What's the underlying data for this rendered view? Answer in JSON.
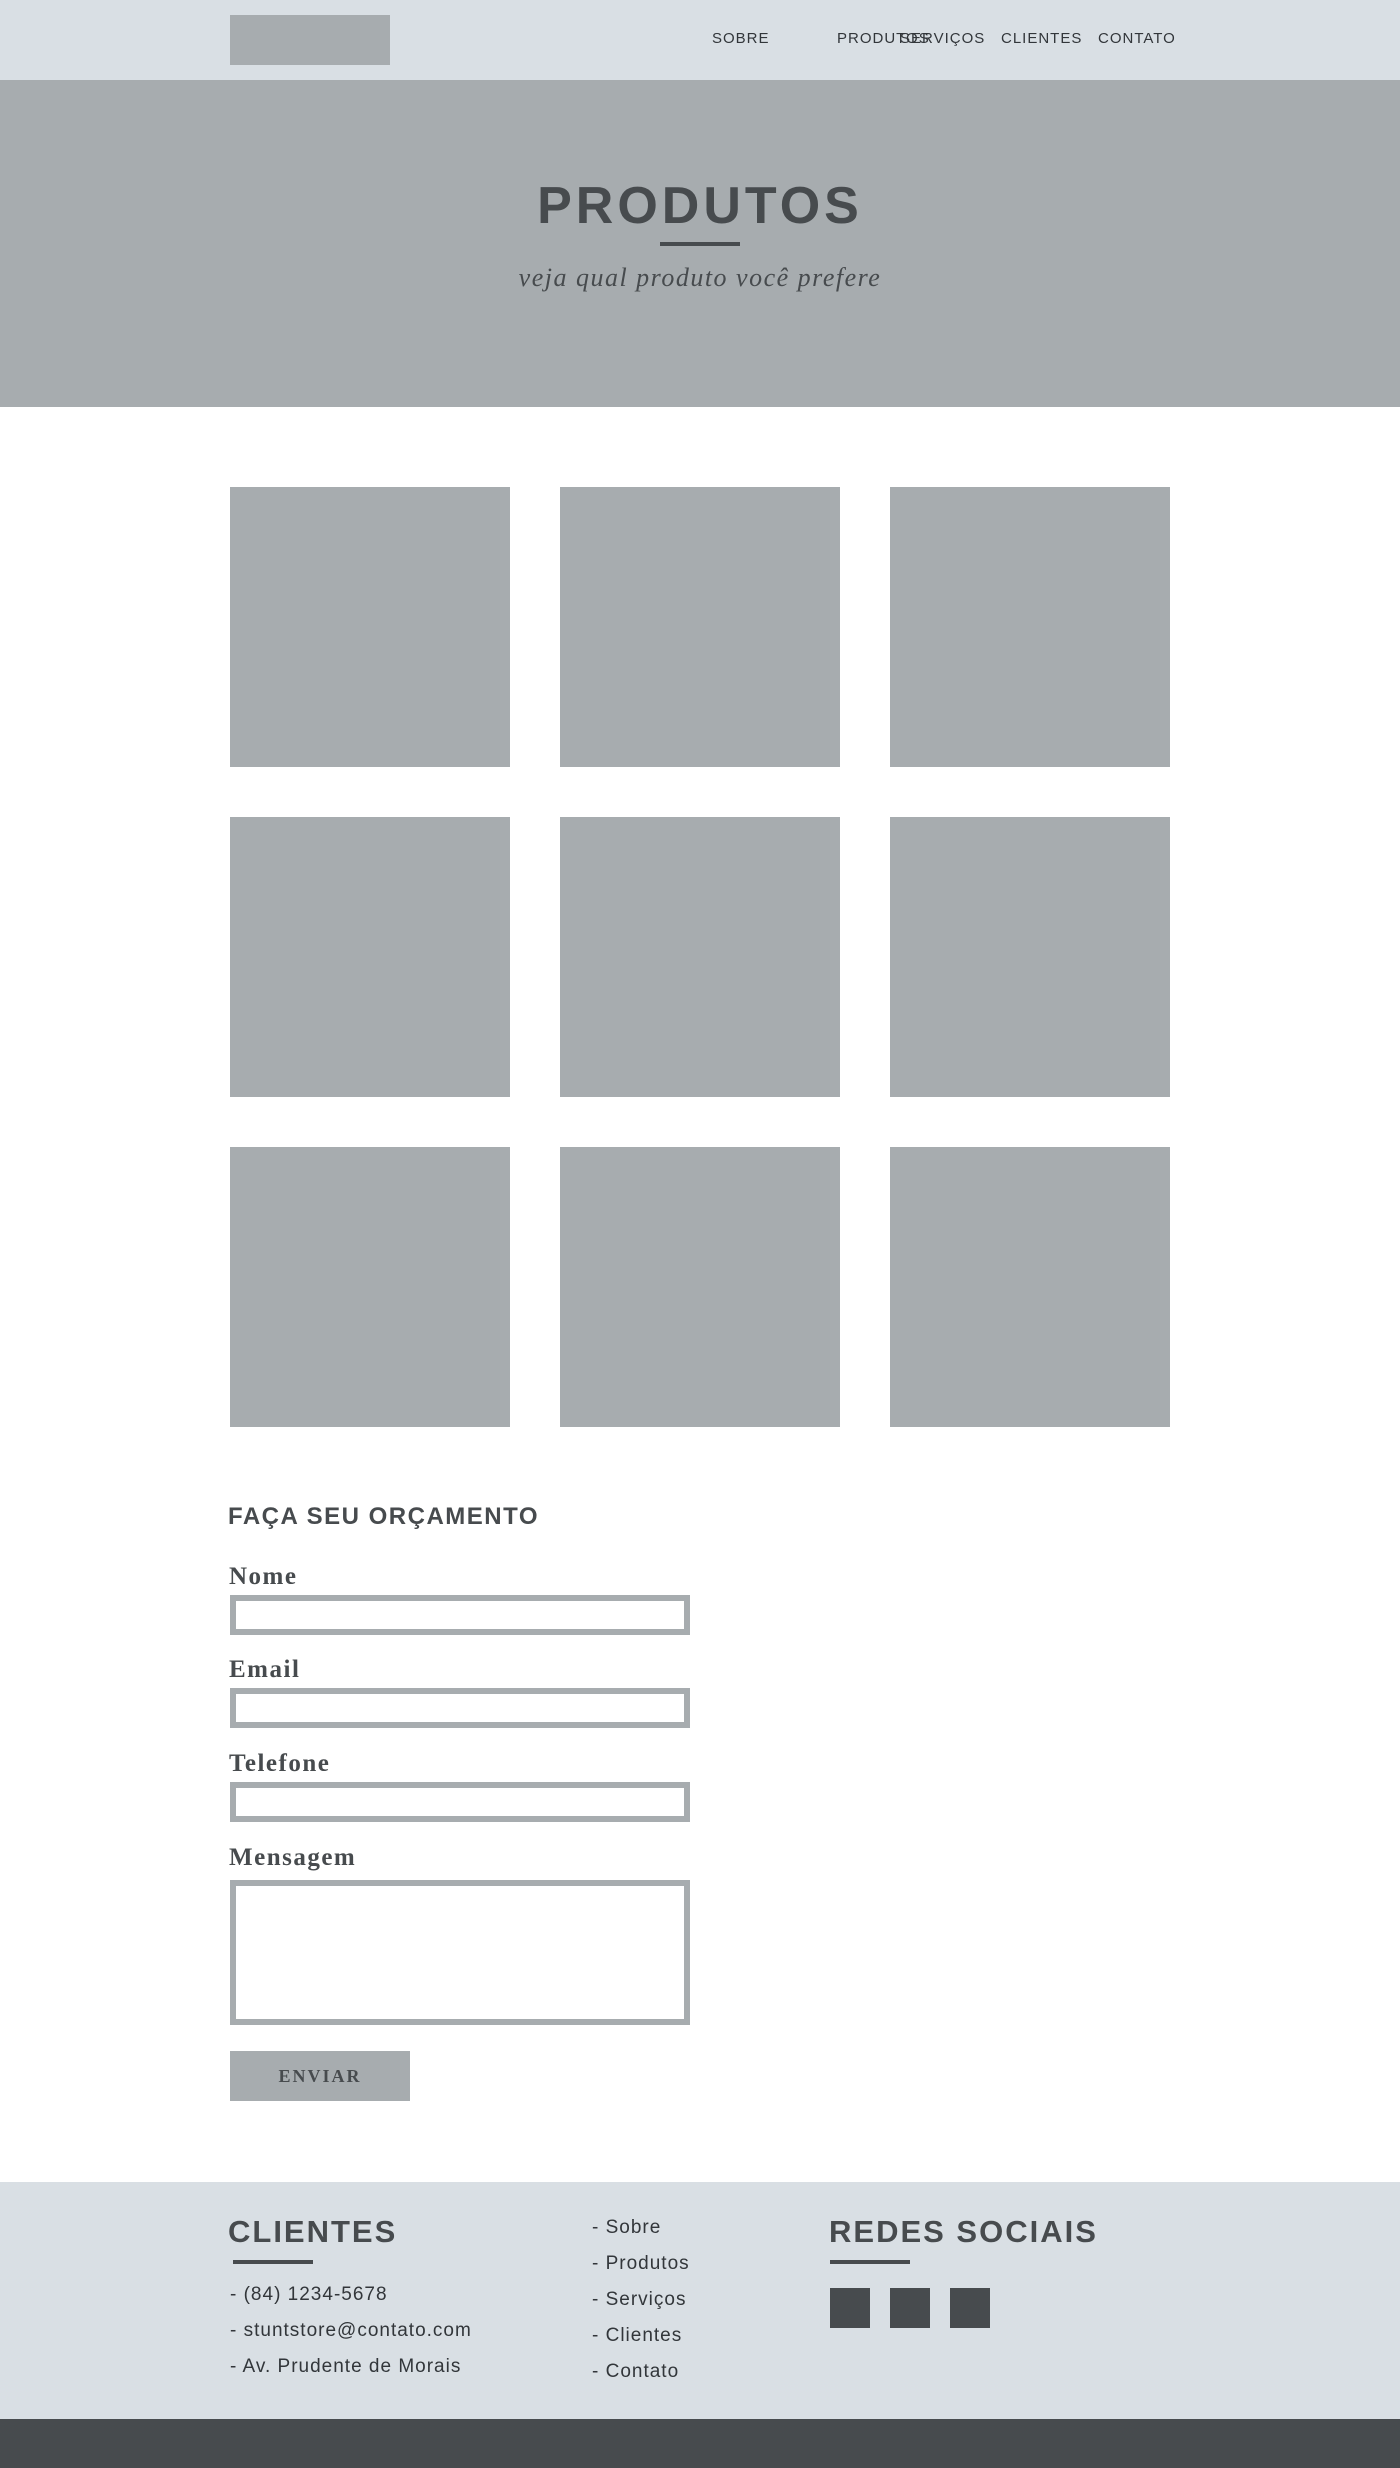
{
  "nav": {
    "items": [
      {
        "label": "SOBRE"
      },
      {
        "label": "PRODUTOS"
      },
      {
        "label": "SERVIÇOS"
      },
      {
        "label": "CLIENTES"
      },
      {
        "label": "CONTATO"
      }
    ]
  },
  "hero": {
    "title": "PRODUTOS",
    "subtitle": "veja qual produto você prefere"
  },
  "products": {
    "count": 9
  },
  "form": {
    "heading": "FAÇA SEU ORÇAMENTO",
    "name_label": "Nome",
    "email_label": "Email",
    "phone_label": "Telefone",
    "message_label": "Mensagem",
    "name_value": "",
    "email_value": "",
    "phone_value": "",
    "message_value": "",
    "submit_label": "ENVIAR"
  },
  "footer": {
    "clients_heading": "CLIENTES",
    "contact_lines": [
      "- (84) 1234-5678",
      "- stuntstore@contato.com",
      "- Av. Prudente de Morais"
    ],
    "links": [
      "- Sobre",
      "- Produtos",
      "- Serviços",
      "- Clientes",
      "- Contato"
    ],
    "social_heading": "REDES SOCIAIS",
    "social_icons": [
      "social-icon",
      "social-icon",
      "social-icon"
    ]
  },
  "colors": {
    "light_bg": "#d9dfe4",
    "placeholder_gray": "#a7acaf",
    "dark_gray": "#474b4e",
    "text_dark": "#32363a"
  }
}
